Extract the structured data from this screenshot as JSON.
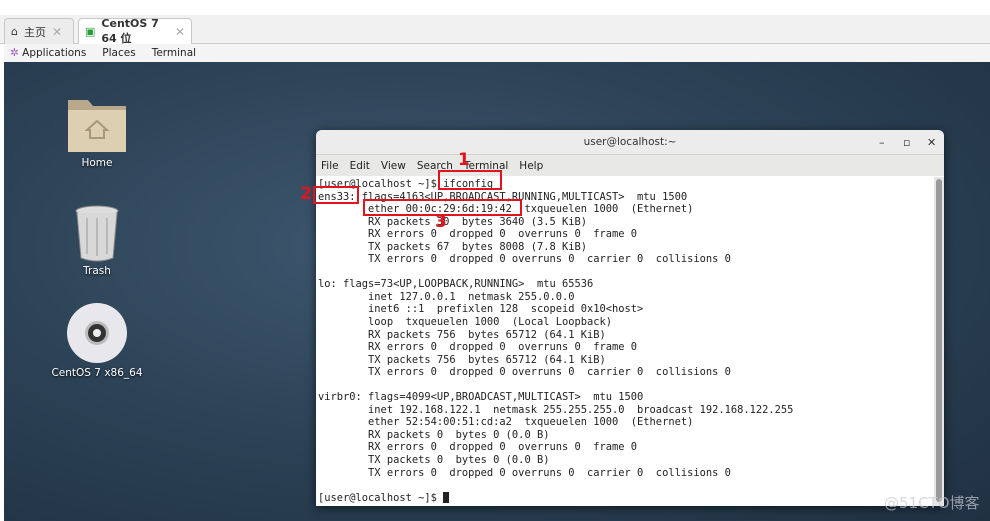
{
  "tabs": [
    {
      "label": "主页",
      "icon": "home-icon"
    },
    {
      "label": "CentOS 7 64 位",
      "icon": "vm-icon"
    }
  ],
  "gnome_bar": {
    "applications": "Applications",
    "places": "Places",
    "terminal": "Terminal"
  },
  "desktop_icons": [
    {
      "label": "Home",
      "icon": "folder-home-icon"
    },
    {
      "label": "Trash",
      "icon": "trash-icon"
    },
    {
      "label": "CentOS 7 x86_64",
      "icon": "disc-icon"
    }
  ],
  "terminal": {
    "title": "user@localhost:~",
    "menu": [
      "File",
      "Edit",
      "View",
      "Search",
      "Terminal",
      "Help"
    ],
    "lines": [
      "[user@localhost ~]$ ifconfig",
      "ens33: flags=4163<UP,BROADCAST,RUNNING,MULTICAST>  mtu 1500",
      "        ether 00:0c:29:6d:19:42  txqueuelen 1000  (Ethernet)",
      "        RX packets 30  bytes 3640 (3.5 KiB)",
      "        RX errors 0  dropped 0  overruns 0  frame 0",
      "        TX packets 67  bytes 8008 (7.8 KiB)",
      "        TX errors 0  dropped 0 overruns 0  carrier 0  collisions 0",
      "",
      "lo: flags=73<UP,LOOPBACK,RUNNING>  mtu 65536",
      "        inet 127.0.0.1  netmask 255.0.0.0",
      "        inet6 ::1  prefixlen 128  scopeid 0x10<host>",
      "        loop  txqueuelen 1000  (Local Loopback)",
      "        RX packets 756  bytes 65712 (64.1 KiB)",
      "        RX errors 0  dropped 0  overruns 0  frame 0",
      "        TX packets 756  bytes 65712 (64.1 KiB)",
      "        TX errors 0  dropped 0 overruns 0  carrier 0  collisions 0",
      "",
      "virbr0: flags=4099<UP,BROADCAST,MULTICAST>  mtu 1500",
      "        inet 192.168.122.1  netmask 255.255.255.0  broadcast 192.168.122.255",
      "        ether 52:54:00:51:cd:a2  txqueuelen 1000  (Ethernet)",
      "        RX packets 0  bytes 0 (0.0 B)",
      "        RX errors 0  dropped 0  overruns 0  frame 0",
      "        TX packets 0  bytes 0 (0.0 B)",
      "        TX errors 0  dropped 0 overruns 0  carrier 0  collisions 0",
      "",
      "[user@localhost ~]$ "
    ]
  },
  "annotations": [
    "1",
    "2",
    "3"
  ],
  "annotation_color": "#e0141e",
  "watermark": "@51CTO博客"
}
